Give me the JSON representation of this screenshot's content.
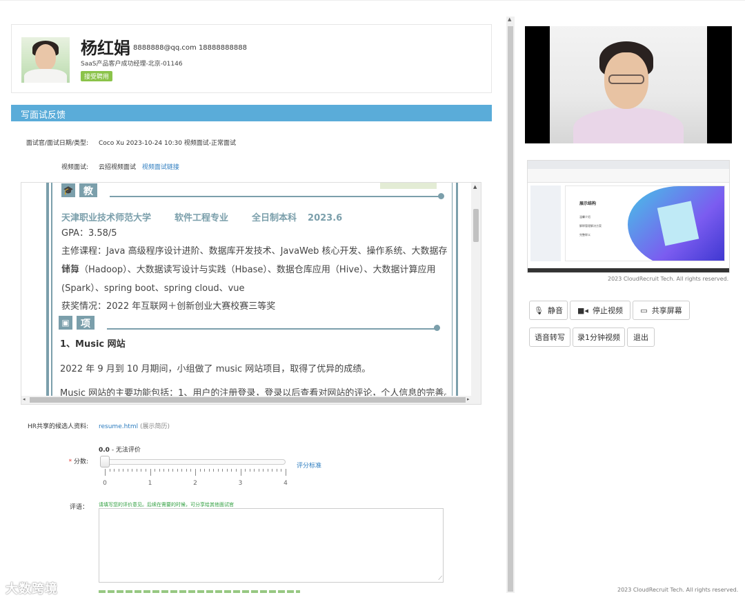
{
  "candidate": {
    "name": "杨红娟",
    "contact": "8888888@qq.com 18888888888",
    "position": "SaaS产品客户成功经理-北京-01146",
    "badge": "接受聘用"
  },
  "section_title": "写面试反馈",
  "interview_info": {
    "label": "面试官/面试日期/类型:",
    "value": "Coco Xu 2023-10-24 10:30 视频面试-正常面试"
  },
  "video_interview": {
    "label": "视频面试:",
    "value": "云招视频面试",
    "link": "视频面试链接"
  },
  "resume": {
    "education": {
      "heading": "教育背景",
      "school": "天津职业技术师范大学",
      "major": "软件工程专业",
      "degree": "全日制本科",
      "date": "2023.6",
      "gpa": "GPA：3.58/5",
      "courses_1": "主修课程：Java 高级程序设计进阶、数据库开发技术、JavaWeb 核心开发、操作系统、大数据存储与",
      "courses_2": "计算（Hadoop）、大数据读写设计与实践（Hbase）、数据仓库应用（Hive）、大数据计算应用",
      "courses_3": "(Spark）、spring boot、spring cloud、vue",
      "awards": "获奖情况：2022 年互联网＋创新创业大赛校赛三等奖"
    },
    "projects": {
      "heading": "项目经历",
      "title": "1、Music 网站",
      "line_1": "2022 年 9 月到 10 月期间，小组做了 music 网站项目，取得了优异的成绩。",
      "line_2": "Music 网站的主要功能包括：1、用户的注册登录，登录以后查看对网站的评论，个人信息的完善。以"
    }
  },
  "hr_shared": {
    "label": "HR共享的候选人资料:",
    "file": "resume.html",
    "file_note": "(展示简历)"
  },
  "score": {
    "label": "分数:",
    "value_text": "0.0",
    "value_desc": " - 无法评价",
    "value": 0,
    "min": 0,
    "max": 4,
    "tick_labels": [
      "0",
      "1",
      "2",
      "3",
      "4"
    ],
    "standard_link": "评分标准"
  },
  "comment": {
    "label": "评语：",
    "hint": "请填写您的评价意见。后续在需要的时候，可分享给其他面试官",
    "value": ""
  },
  "share_screen": {
    "copyright": "2023 CloudRecruit Tech. All rights reserved.",
    "slide_title": "展示结构",
    "slide_items": [
      "温馨介绍",
      "解释管理解决方案",
      "完整释义"
    ]
  },
  "controls": {
    "mute": "静音",
    "stop_video": "停止视频",
    "share_screen": "共享屏幕",
    "transcribe": "语音转写",
    "record": "录1分钟视频",
    "exit": "退出"
  },
  "footer": "2023 CloudRecruit Tech. All rights reserved.",
  "watermark": "大数跨境",
  "colors": {
    "section_bar": "#5aacd9",
    "badge": "#8bc34a",
    "resume_accent": "#7b9fab",
    "link": "#2c7cbf",
    "hint": "#2e9e3e"
  }
}
